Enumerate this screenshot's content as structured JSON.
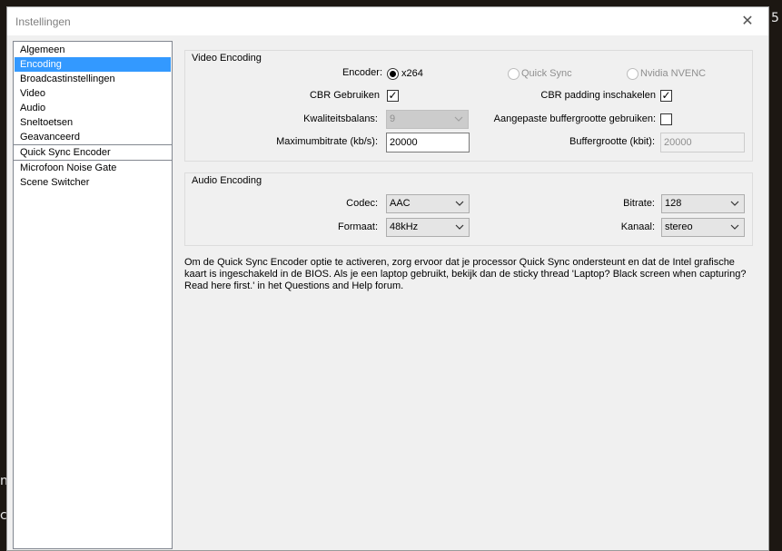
{
  "window": {
    "title": "Instellingen",
    "close_glyph": "✕"
  },
  "backdrop": {
    "edge_glyph_top": "5",
    "edge_glyph_mid": "n",
    "edge_glyph_low": "c"
  },
  "sidebar": {
    "items": [
      {
        "label": "Algemeen"
      },
      {
        "label": "Encoding",
        "selected": true
      },
      {
        "label": "Broadcastinstellingen"
      },
      {
        "label": "Video"
      },
      {
        "label": "Audio"
      },
      {
        "label": "Sneltoetsen"
      },
      {
        "label": "Geavanceerd"
      },
      {
        "label": "Quick Sync Encoder"
      },
      {
        "label": "Microfoon Noise Gate"
      },
      {
        "label": "Scene Switcher"
      }
    ]
  },
  "video_encoding": {
    "title": "Video Encoding",
    "encoder_label": "Encoder:",
    "encoder_options": [
      {
        "label": "x264",
        "checked": true,
        "enabled": true
      },
      {
        "label": "Quick Sync",
        "checked": false,
        "enabled": false
      },
      {
        "label": "Nvidia NVENC",
        "checked": false,
        "enabled": false
      }
    ],
    "cbr_label": "CBR Gebruiken",
    "cbr_checked": true,
    "cbr_padding_label": "CBR padding inschakelen",
    "cbr_padding_checked": true,
    "quality_label": "Kwaliteitsbalans:",
    "quality_value": "9",
    "custom_buffer_label": "Aangepaste buffergrootte gebruiken:",
    "custom_buffer_checked": false,
    "max_bitrate_label": "Maximumbitrate (kb/s):",
    "max_bitrate_value": "20000",
    "buffer_size_label": "Buffergrootte (kbit):",
    "buffer_size_value": "20000"
  },
  "audio_encoding": {
    "title": "Audio Encoding",
    "codec_label": "Codec:",
    "codec_value": "AAC",
    "bitrate_label": "Bitrate:",
    "bitrate_value": "128",
    "format_label": "Formaat:",
    "format_value": "48kHz",
    "channel_label": "Kanaal:",
    "channel_value": "stereo"
  },
  "info_text": "Om de Quick Sync Encoder optie te activeren, zorg ervoor dat je processor Quick Sync ondersteunt en dat de Intel grafische kaart is ingeschakeld in de BIOS. Als je een laptop gebruikt, bekijk dan de sticky thread 'Laptop? Black screen when capturing? Read here first.' in het Questions and Help forum.",
  "icons": {
    "check_glyph": "✓"
  }
}
